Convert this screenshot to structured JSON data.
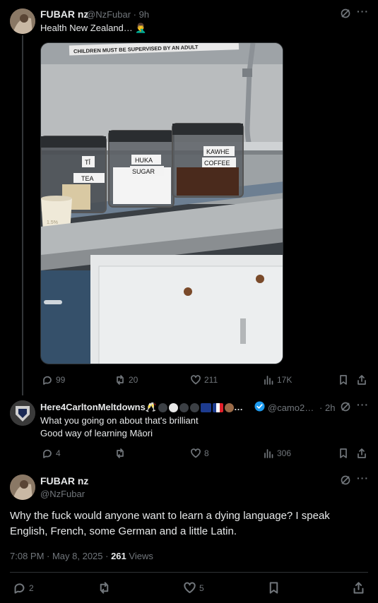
{
  "post1": {
    "display_name": "FUBAR nz",
    "handle": "@NzFubar",
    "sep": "·",
    "time": "9h",
    "text": "Health New Zealand… 🤦‍♂️",
    "image": {
      "sign_text": "CHILDREN MUST BE SUPERVISED BY AN ADULT",
      "label_tea_1": "TĪ",
      "label_tea_2": "TEA",
      "label_sugar_1": "HUKA",
      "label_sugar_2": "SUGAR",
      "label_coffee_1": "KAWHE",
      "label_coffee_2": "COFFEE",
      "cup_text": "1.5%"
    },
    "stats": {
      "replies": "99",
      "reposts": "20",
      "likes": "211",
      "views": "17K"
    }
  },
  "post2": {
    "display_name": "Here4CarltonMeltdowns🥂",
    "name_tail": "…",
    "handle": "@camo2…",
    "sep": "·",
    "time": "2h",
    "line1": "What you going on about that's brilliant",
    "line2": "Good way of learning Māori",
    "stats": {
      "replies": "4",
      "reposts": "",
      "likes": "8",
      "views": "306"
    }
  },
  "post3": {
    "display_name": "FUBAR nz",
    "handle": "@NzFubar",
    "text": "Why the fuck would anyone want to learn a dying language? I speak English, French, some German and a little Latin.",
    "timestamp": "7:08 PM · May 8, 2025 · ",
    "views_count": "261",
    "views_label": " Views",
    "stats": {
      "replies": "2",
      "reposts": "",
      "likes": "5"
    }
  },
  "colors": {
    "background": "#000000",
    "text": "#e7e9ea",
    "muted": "#71767b",
    "verified": "#1d9bf0",
    "divider": "#2f3336"
  }
}
